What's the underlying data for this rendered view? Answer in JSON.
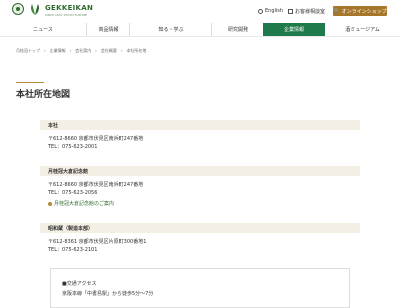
{
  "brand": {
    "name": "GEKKEIKAN",
    "tagline": "SINCE 1637 KYOTO FUSHIMI"
  },
  "utility": {
    "english": "English",
    "contact": "お客様相談室",
    "shop": "オンラインショップ"
  },
  "nav": [
    "ニュース",
    "商品情報",
    "知る・学ぶ",
    "研究開発",
    "企業情報",
    "酒ミュージアム"
  ],
  "breadcrumb": [
    "月桂冠トップ",
    "企業情報",
    "会社案内",
    "会社概要",
    "本社所在地"
  ],
  "page_title": "本社所在地図",
  "sections": [
    {
      "heading": "本社",
      "address": "〒612-8660 京都市伏見区南浜町247番地",
      "tel": "TEL：075-623-2001"
    },
    {
      "heading": "月桂冠大倉記念館",
      "address": "〒612-8660 京都市伏見区南浜町247番地",
      "tel": "TEL：075-623-2056",
      "link": "月桂冠大倉記念館のご案内"
    },
    {
      "heading": "昭和蔵（製造本部）",
      "address": "〒612-8361 京都市伏見区片原町300番地1",
      "tel": "TEL：075-623-2101"
    }
  ],
  "access": {
    "heading": "■交通アクセス",
    "line1": "京阪本線「中書島駅」から徒歩5分～7分"
  },
  "colors": {
    "brand_green": "#1e7a4a",
    "gold": "#a6762a",
    "section_bg": "#f4efe4"
  }
}
